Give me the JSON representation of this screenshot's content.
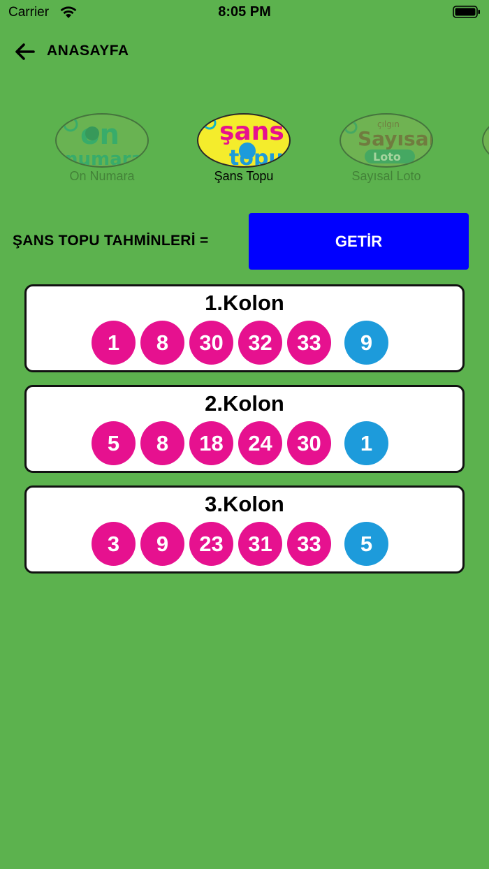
{
  "status_bar": {
    "carrier": "Carrier",
    "time": "8:05 PM"
  },
  "nav": {
    "back_icon": "arrow-left-icon",
    "title": "ANASAYFA"
  },
  "games": [
    {
      "label": "On Numara",
      "logo_text_top": "on",
      "logo_text_bottom": "numara",
      "active": false
    },
    {
      "label": "Şans Topu",
      "logo_text_top": "şans",
      "logo_text_bottom": "topu",
      "active": true
    },
    {
      "label": "Sayısal Loto",
      "logo_text_top": "Sayısal",
      "logo_text_bottom": "Loto",
      "logo_text_small": "çılgın",
      "active": false
    }
  ],
  "prompt": {
    "label": "ŞANS TOPU TAHMİNLERİ =",
    "button_label": "GETİR"
  },
  "colors": {
    "background": "#5cb24e",
    "button": "#0000ff",
    "main_ball": "#e6118f",
    "bonus_ball": "#1d9bdb"
  },
  "kolonlar": [
    {
      "title": "1.Kolon",
      "numbers": [
        "1",
        "8",
        "30",
        "32",
        "33"
      ],
      "bonus": "9"
    },
    {
      "title": "2.Kolon",
      "numbers": [
        "5",
        "8",
        "18",
        "24",
        "30"
      ],
      "bonus": "1"
    },
    {
      "title": "3.Kolon",
      "numbers": [
        "3",
        "9",
        "23",
        "31",
        "33"
      ],
      "bonus": "5"
    }
  ]
}
